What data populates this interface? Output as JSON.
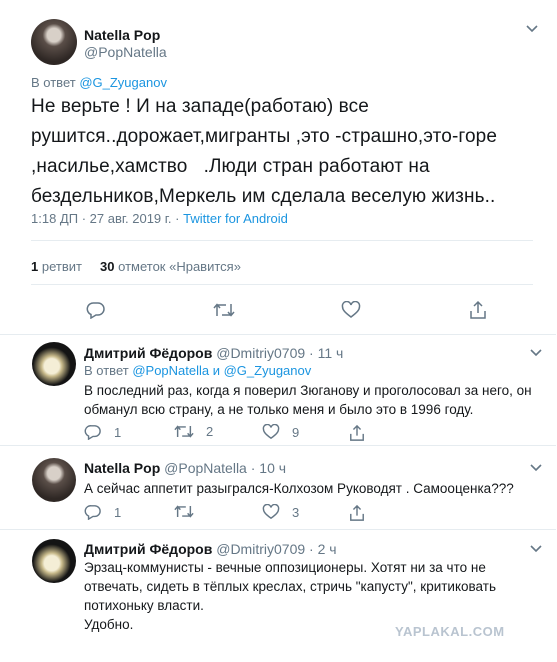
{
  "main_tweet": {
    "author_name": "Natella Pop",
    "author_handle": "@PopNatella",
    "reply_to_prefix": "В ответ",
    "reply_to_user": "@G_Zyuganov",
    "text_lines": [
      "Не верьте ! И на западе(работаю) все",
      "рушится..дорожает,мигранты ,это -страшно,это-горе",
      ",насилье,хамство   .Люди стран работают на",
      "бездельников,Меркель им сделала веселую жизнь.."
    ],
    "time": "1:18 ДП",
    "date": "27 авг. 2019 г.",
    "separator": "·",
    "source": "Twitter for Android",
    "retweets_count": "1",
    "retweets_label": "ретвит",
    "likes_count": "30",
    "likes_label": "отметок «Нравится»"
  },
  "replies": [
    {
      "author_name": "Дмитрий Фёдоров",
      "author_handle": "@Dmitriy0709",
      "time": "· 11 ч",
      "reply_to_prefix": "В ответ",
      "reply_to_users": "@PopNatella и @G_Zyuganov",
      "text": "В последний раз, когда я поверил Зюганову и проголосовал за него, он обманул всю страну, а не только меня и было это в 1996 году.",
      "replies_count": "1",
      "retweets_count": "2",
      "likes_count": "9"
    },
    {
      "author_name": "Natella Pop",
      "author_handle": "@PopNatella",
      "time": "· 10 ч",
      "text": "А сейчас аппетит разыгрался-Колхозом Руководят . Самооценка???",
      "replies_count": "1",
      "retweets_count": "",
      "likes_count": "3"
    },
    {
      "author_name": "Дмитрий Фёдоров",
      "author_handle": "@Dmitriy0709",
      "time": "· 2 ч",
      "text_lines": [
        "Эрзац-коммунисты - вечные оппозиционеры. Хотят ни за что не",
        "отвечать, сидеть в тёплых креслах, стричь \"капусту\", критиковать",
        "потихоньку власти.",
        "Удобно."
      ]
    }
  ],
  "watermark": "YAPLAKAL.COM",
  "icons": [
    "chevron-down-icon",
    "reply-icon",
    "retweet-icon",
    "like-icon",
    "share-icon"
  ],
  "colors": {
    "link": "#1b95e0",
    "secondary_text": "#657786",
    "divider": "#e6ecf0"
  }
}
